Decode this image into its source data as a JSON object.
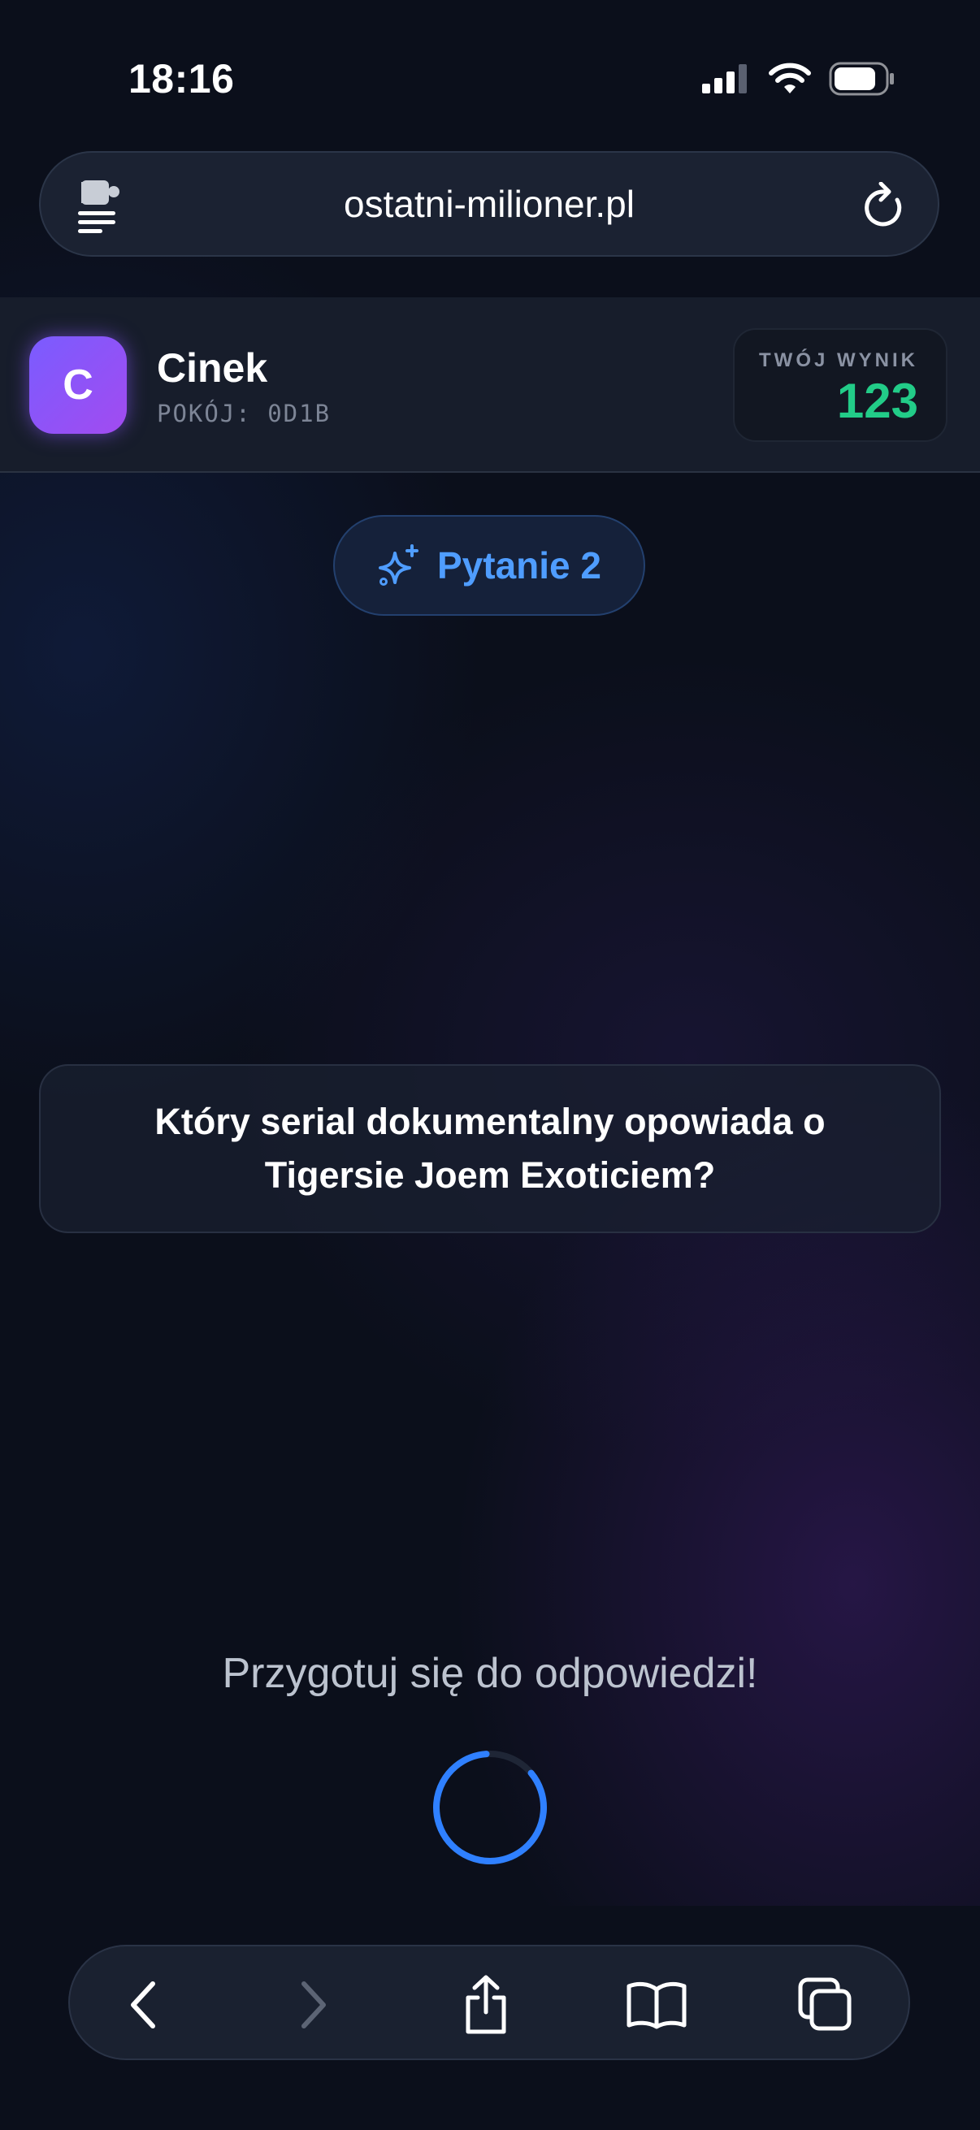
{
  "status_bar": {
    "time": "18:16",
    "icons": [
      "cellular-signal-icon",
      "wifi-icon",
      "battery-icon"
    ]
  },
  "browser": {
    "url": "ostatni-milioner.pl",
    "left_icon": "extension-menu-icon",
    "right_icon": "reload-icon"
  },
  "player": {
    "avatar_letter": "C",
    "name": "Cinek",
    "room": "POKÓJ: 0D1B"
  },
  "score": {
    "label": "TWÓJ WYNIK",
    "value": "123"
  },
  "question_badge": {
    "icon": "sparkles-icon",
    "label": "Pytanie 2"
  },
  "question": {
    "text": "Który serial dokumentalny opowiada o Tigersie Joem Exoticiem?"
  },
  "prompt": {
    "text": "Przygotuj się do odpowiedzi!",
    "spinner_progress": 0.85
  },
  "toolbar": {
    "buttons": [
      "back-icon",
      "forward-icon",
      "share-icon",
      "bookmarks-icon",
      "tabs-icon"
    ]
  },
  "colors": {
    "accent_blue": "#4f9dff",
    "score_green": "#22cc88",
    "avatar_purple": "#8a55f8",
    "background": "#0b0f1b"
  }
}
